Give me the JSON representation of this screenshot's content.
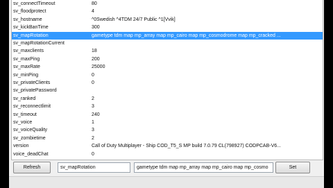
{
  "list": {
    "rows": [
      {
        "key": "sv_connectTimeout",
        "value": "80"
      },
      {
        "key": "sv_floodprotect",
        "value": "4"
      },
      {
        "key": "sv_hostname",
        "value": "^0Swedish ^4TDM 24/7 Public ^1[Vvik]"
      },
      {
        "key": "sv_kickBanTime",
        "value": "300"
      },
      {
        "key": "sv_mapRotation",
        "value": "gametype tdm map mp_array map mp_cairo map mp_cosmodrome map mp_cracked ..."
      },
      {
        "key": "sv_mapRotationCurrent",
        "value": ""
      },
      {
        "key": "sv_maxclients",
        "value": "18"
      },
      {
        "key": "sv_maxPing",
        "value": "200"
      },
      {
        "key": "sv_maxRate",
        "value": "25000"
      },
      {
        "key": "sv_minPing",
        "value": "0"
      },
      {
        "key": "sv_privateClients",
        "value": "0"
      },
      {
        "key": "sv_privatePassword",
        "value": ""
      },
      {
        "key": "sv_ranked",
        "value": "2"
      },
      {
        "key": "sv_reconnectlimit",
        "value": "3"
      },
      {
        "key": "sv_timeout",
        "value": "240"
      },
      {
        "key": "sv_voice",
        "value": "1"
      },
      {
        "key": "sv_voiceQuality",
        "value": "3"
      },
      {
        "key": "sv_zombietime",
        "value": "2"
      },
      {
        "key": "version",
        "value": "Call of Duty Multiplayer - Ship COD_T5_S MP build 7.0.79 CL(798927) CODPCAB-V6..."
      },
      {
        "key": "voice_deadChat",
        "value": "0"
      }
    ],
    "selected_index": 4
  },
  "bottom": {
    "refresh_label": "Refresh",
    "name_value": "sv_mapRotation",
    "value_value": "gametype tdm map mp_array map mp_cairo map mp_cosmo",
    "set_label": "Set"
  },
  "colors": {
    "selection": "#3399ff",
    "window_bg": "#f0f0f0"
  }
}
